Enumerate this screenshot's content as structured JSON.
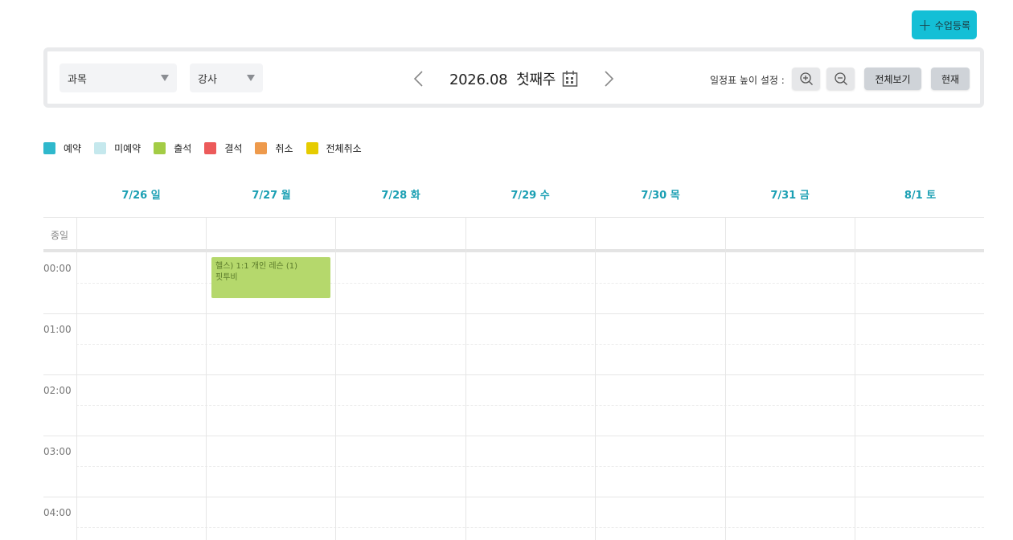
{
  "header": {
    "register_label": "수업등록"
  },
  "toolbar": {
    "subject_select": "과목",
    "teacher_select": "강사",
    "week_title": "2026.08  첫째주",
    "height_setting_label": "일정표 높이 설정 :",
    "view_all_label": "전체보기",
    "current_label": "현재"
  },
  "legend": [
    {
      "label": "예약",
      "color": "#2fb8cc"
    },
    {
      "label": "미예약",
      "color": "#c5e8ed"
    },
    {
      "label": "출석",
      "color": "#a3cc45"
    },
    {
      "label": "결석",
      "color": "#ec5a5a"
    },
    {
      "label": "취소",
      "color": "#ee9a4c"
    },
    {
      "label": "전체취소",
      "color": "#e6cc00"
    }
  ],
  "calendar": {
    "days": [
      "7/26 일",
      "7/27 월",
      "7/28 화",
      "7/29 수",
      "7/30 목",
      "7/31 금",
      "8/1 토"
    ],
    "allday_label": "종일",
    "times": [
      "00:00",
      "01:00",
      "02:00",
      "03:00",
      "04:00"
    ],
    "events": [
      {
        "title": "헬스) 1:1 개인 레슨 (1)",
        "teacher": "핏투비",
        "day": "7/27 월",
        "start": "00:00",
        "color": "#b5d86c"
      }
    ]
  }
}
